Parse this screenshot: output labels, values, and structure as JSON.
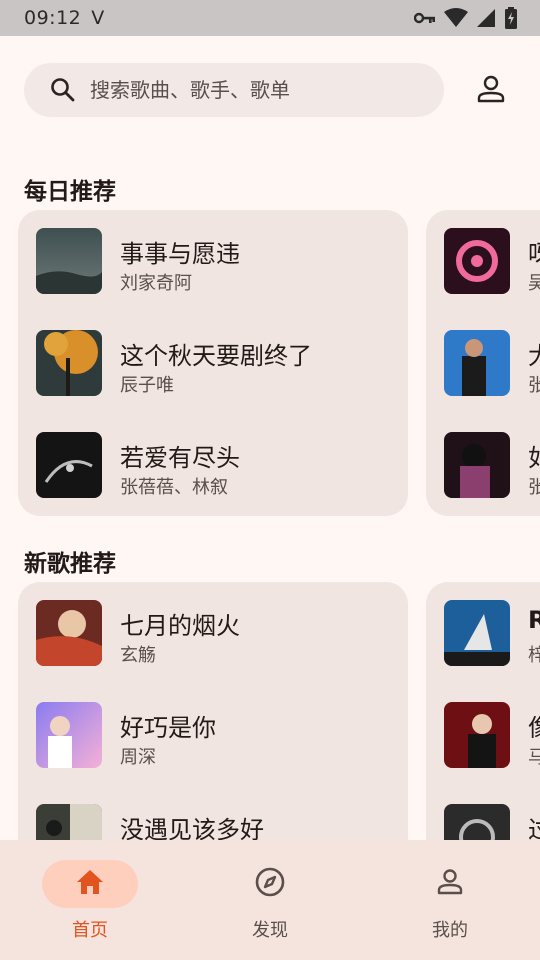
{
  "status_bar": {
    "time": "09:12",
    "carrier_glyph": "V",
    "icons": [
      "vpn-key-icon",
      "wifi-icon",
      "signal-icon",
      "battery-charging-icon"
    ]
  },
  "search": {
    "placeholder": "搜索歌曲、歌手、歌单"
  },
  "sections": {
    "daily": {
      "title": "每日推荐",
      "songs": [
        {
          "title": "事事与愿违",
          "artist": "刘家奇阿"
        },
        {
          "title": "这个秋天要剧终了",
          "artist": "辰子唯"
        },
        {
          "title": "若爱有尽头",
          "artist": "张蓓蓓、林叙"
        }
      ],
      "songs_next_column": [
        {
          "title": "呀",
          "artist": "吴"
        },
        {
          "title": "大",
          "artist": "张"
        },
        {
          "title": "如",
          "artist": "张"
        }
      ]
    },
    "new_songs": {
      "title": "新歌推荐",
      "songs": [
        {
          "title": "七月的烟火",
          "artist": "玄觞"
        },
        {
          "title": "好巧是你",
          "artist": "周深"
        },
        {
          "title": "没遇见该多好",
          "artist": ""
        }
      ],
      "songs_next_column": [
        {
          "title": "R",
          "artist": "梓"
        },
        {
          "title": "像",
          "artist": "马"
        },
        {
          "title": "过",
          "artist": ""
        }
      ]
    }
  },
  "bottom_nav": {
    "items": [
      {
        "label": "首页",
        "icon": "home-icon",
        "active": true
      },
      {
        "label": "发现",
        "icon": "compass-icon",
        "active": false
      },
      {
        "label": "我的",
        "icon": "person-icon",
        "active": false
      }
    ]
  },
  "colors": {
    "accent": "#e2541f",
    "active_pill": "#ffcfbe",
    "card": "#f1e5e1",
    "background": "#fff7f4"
  }
}
